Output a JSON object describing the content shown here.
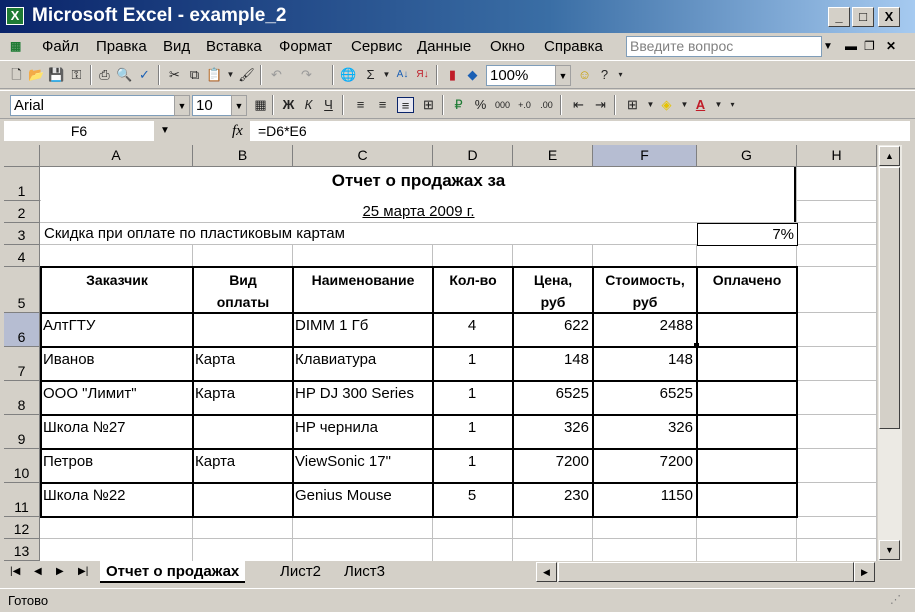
{
  "window": {
    "app_icon": "excel-icon",
    "title": "Microsoft Excel - example_2",
    "buttons": [
      "_",
      "□",
      "X"
    ]
  },
  "menu": {
    "items": [
      "Файл",
      "Правка",
      "Вид",
      "Вставка",
      "Формат",
      "Сервис",
      "Данные",
      "Окно",
      "Справка"
    ],
    "help_placeholder": "Введите вопрос"
  },
  "standard_toolbar": {
    "zoom": "100%"
  },
  "format_toolbar": {
    "font": "Arial",
    "size": "10",
    "bold_label": "Ж",
    "italic_label": "К",
    "underline_label": "Ч",
    "percent_label": "%",
    "thousands_label": "000"
  },
  "formula_bar": {
    "name_box": "F6",
    "fx_label": "fx",
    "formula": "=D6*E6"
  },
  "grid": {
    "columns": [
      "A",
      "B",
      "C",
      "D",
      "E",
      "F",
      "G",
      "H"
    ],
    "rows": [
      "1",
      "2",
      "3",
      "4",
      "5",
      "6",
      "7",
      "8",
      "9",
      "10",
      "11",
      "12",
      "13"
    ],
    "selected_column": "F",
    "selected_row": "6",
    "title": "Отчет о продажах за",
    "date": "25 марта 2009 г.",
    "discount_label": "Скидка при оплате по пластиковым картам",
    "discount_value": "7%",
    "table_headers": [
      [
        "Заказчик"
      ],
      [
        "Вид",
        "оплаты"
      ],
      [
        "Наименование"
      ],
      [
        "Кол-во"
      ],
      [
        "Цена,",
        "руб"
      ],
      [
        "Стоимость,",
        "руб"
      ],
      [
        "Оплачено"
      ]
    ],
    "table_rows": [
      [
        "АлтГТУ",
        "",
        "DIMM 1 Гб",
        "4",
        "622",
        "2488",
        ""
      ],
      [
        "Иванов",
        "Карта",
        "Клавиатура",
        "1",
        "148",
        "148",
        ""
      ],
      [
        "ООО \"Лимит\"",
        "Карта",
        "HP DJ 300 Series",
        "1",
        "6525",
        "6525",
        ""
      ],
      [
        "Школа №27",
        "",
        "HP чернила",
        "1",
        "326",
        "326",
        ""
      ],
      [
        "Петров",
        "Карта",
        "ViewSonic 17\"",
        "1",
        "7200",
        "7200",
        ""
      ],
      [
        "Школа №22",
        "",
        "Genius Mouse",
        "5",
        "230",
        "1150",
        ""
      ]
    ]
  },
  "sheet_tabs": [
    "Отчет о продажах",
    "Лист2",
    "Лист3"
  ],
  "status": "Готово"
}
